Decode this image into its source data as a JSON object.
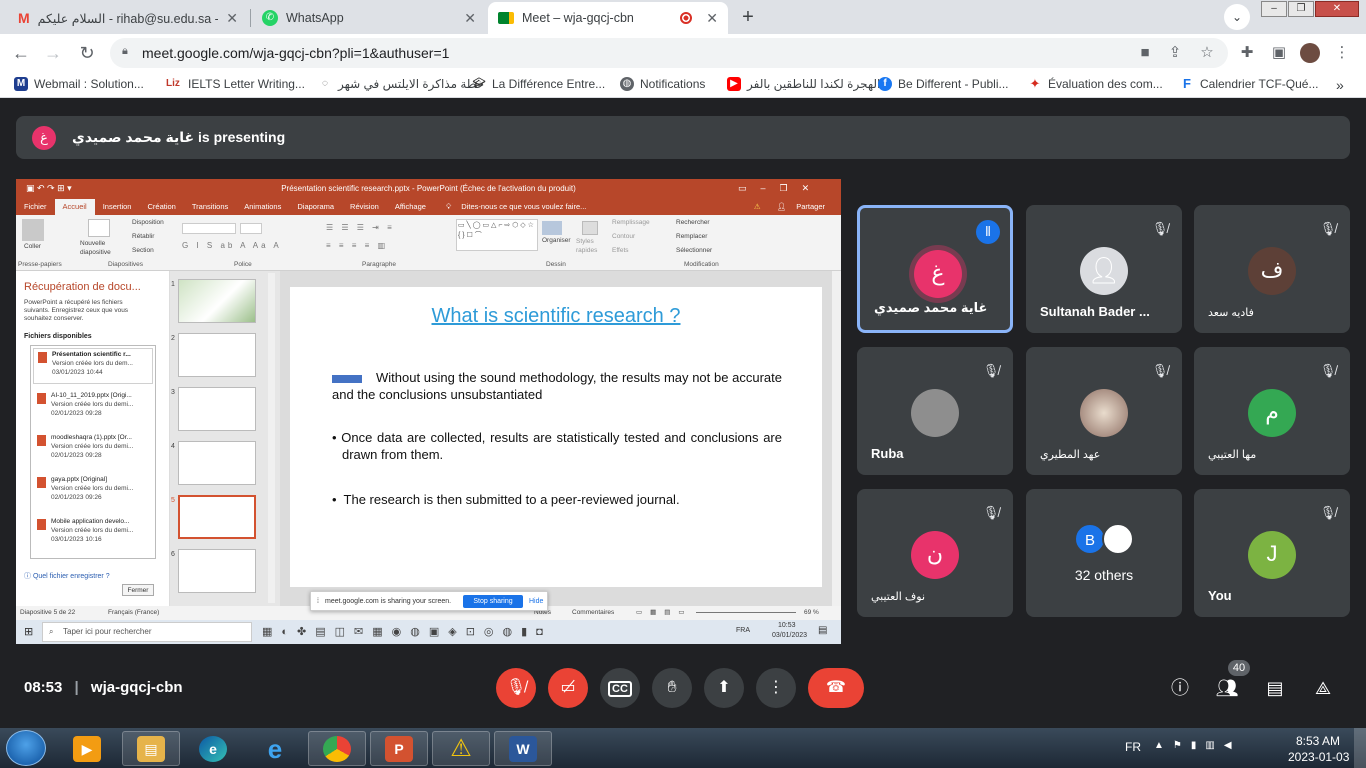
{
  "browser": {
    "tabs": [
      {
        "label": "السلام عليكم - rihab@su.edu.sa - جامعة",
        "icon": "gmail-icon",
        "active": false
      },
      {
        "label": "WhatsApp",
        "icon": "whatsapp-icon",
        "active": false
      },
      {
        "label": "Meet – wja-gqcj-cbn",
        "icon": "meet-icon",
        "active": true
      }
    ],
    "new_tab": "+",
    "url": "meet.google.com/wja-gqcj-cbn?pli=1&authuser=1",
    "bookmarks": [
      {
        "label": "Webmail : Solution...",
        "icon": "webmail-icon",
        "color": "#1f3e8f",
        "glyph": "M"
      },
      {
        "label": "IELTS Letter Writing...",
        "icon": "liz-icon",
        "color": "#c0392b",
        "glyph": "Liz"
      },
      {
        "label": "خطة مذاكرة الايلتس في شهر",
        "icon": "loader-icon",
        "color": "#555555",
        "glyph": "O"
      },
      {
        "label": "La Différence Entre...",
        "icon": "graduation-icon",
        "color": "#333333",
        "glyph": "▲"
      },
      {
        "label": "Notifications",
        "icon": "globe-icon",
        "color": "#5f6368",
        "glyph": "●"
      },
      {
        "label": "الهجرة لكندا للناطقين بالفر...",
        "icon": "youtube-icon",
        "color": "#ff0000",
        "glyph": "▶"
      },
      {
        "label": "Be Different - Publi...",
        "icon": "facebook-icon",
        "color": "#1877f2",
        "glyph": "f"
      },
      {
        "label": "Évaluation des com...",
        "icon": "maple-icon",
        "color": "#d52b1e",
        "glyph": "✦"
      },
      {
        "label": "Calendrier TCF-Qué...",
        "icon": "calendar-icon",
        "color": "#1a73e8",
        "glyph": "F"
      }
    ],
    "bookmarks_more": "»"
  },
  "meet": {
    "presenter_initial": "غ",
    "presenting_text": "غاية محمد صميدي is presenting",
    "participants": [
      {
        "name": "غاية محمد صميدي",
        "initial": "غ",
        "color": "#e8336b",
        "speaking": true,
        "muted": false
      },
      {
        "name": "Sultanah Bader ...",
        "initial": "",
        "color": "#dadce0",
        "speaking": false,
        "muted": true
      },
      {
        "name": "فاديه سعد",
        "initial": "ف",
        "color": "#5d4037",
        "speaking": false,
        "muted": true
      },
      {
        "name": "Ruba",
        "initial": "",
        "color": "#9e9e9e",
        "speaking": false,
        "muted": true
      },
      {
        "name": "عهد المطيري",
        "initial": "",
        "color": "#8d6e63",
        "speaking": false,
        "muted": true
      },
      {
        "name": "مها العتيبي",
        "initial": "م",
        "color": "#34a853",
        "speaking": false,
        "muted": true
      },
      {
        "name": "نوف العتيبي",
        "initial": "ن",
        "color": "#e8336b",
        "speaking": false,
        "muted": true
      },
      {
        "name": "32 others",
        "initial": "B",
        "color": "#1a73e8",
        "speaking": false,
        "muted": false
      },
      {
        "name": "You",
        "initial": "J",
        "color": "#7cb342",
        "speaking": false,
        "muted": true
      }
    ],
    "time": "08:53",
    "meeting_code": "wja-gqcj-cbn",
    "participant_count": "40"
  },
  "ppt": {
    "window_title": "Présentation scientific research.pptx - PowerPoint (Échec de l'activation du produit)",
    "ribbon_tabs": [
      "Fichier",
      "Accueil",
      "Insertion",
      "Création",
      "Transitions",
      "Animations",
      "Diaporama",
      "Révision",
      "Affichage"
    ],
    "tell_me": "Dites-nous ce que vous voulez faire...",
    "share_label": "Partager",
    "ribbon_groups": [
      "Presse-papiers",
      "Diapositives",
      "Police",
      "Paragraphe",
      "Dessin",
      "Modification"
    ],
    "ribbon_buttons": {
      "paste": "Coller",
      "new_slide": "Nouvelle diapositive",
      "layout": "Disposition",
      "reset": "Rétablir",
      "section": "Section",
      "organize": "Organiser",
      "quick_styles": "Styles rapides",
      "fill": "Remplissage",
      "outline": "Contour",
      "effects": "Effets",
      "find": "Rechercher",
      "replace": "Remplacer",
      "select": "Sélectionner"
    },
    "recovery": {
      "title": "Récupération de docu...",
      "desc": "PowerPoint a récupéré les fichiers suivants. Enregistrez ceux que vous souhaitez conserver.",
      "available": "Fichiers disponibles",
      "files": [
        {
          "name": "Présentation scientific r...",
          "line2": "Version créée lors du dem...",
          "date": "03/01/2023 10:44"
        },
        {
          "name": "AI-10_11_2019.pptx [Origi...",
          "line2": "Version créée lors du demi...",
          "date": "02/01/2023 09:28"
        },
        {
          "name": "moodleshaqra (1).pptx [Or...",
          "line2": "Version créée lors du demi...",
          "date": "02/01/2023 09:28"
        },
        {
          "name": "gaya.pptx [Original]",
          "line2": "Version créée lors du demi...",
          "date": "02/01/2023 09:26"
        },
        {
          "name": "Mobile application develo...",
          "line2": "Version créée lors du demi...",
          "date": "03/01/2023 10:16"
        }
      ],
      "which_file": "Quel fichier enregistrer ?",
      "close": "Fermer"
    },
    "thumb_numbers": [
      "1",
      "2",
      "3",
      "4",
      "5",
      "6"
    ],
    "slide": {
      "title": "What is scientific research ?",
      "bullet1": "Without using the sound methodology, the results may not be accurate and the conclusions unsubstantiated",
      "bullet2": "Once data are collected, results are statistically tested and conclusions are drawn from them.",
      "bullet3": "The research is then submitted to a peer-reviewed journal."
    },
    "status": {
      "slide_of": "Diapositive 5 de 22",
      "lang": "Français (France)",
      "notes": "Notes",
      "comments": "Commentaires",
      "zoom": "69 %"
    },
    "sharing_bar": {
      "text": "meet.google.com is sharing your screen.",
      "stop": "Stop sharing",
      "hide": "Hide"
    },
    "win_search": "Taper ici pour rechercher",
    "win_lang": "FRA",
    "win_time": "10:53",
    "win_date": "03/01/2023"
  },
  "taskbar": {
    "lang": "FR",
    "time": "8:53 AM",
    "date": "2023-01-03"
  }
}
